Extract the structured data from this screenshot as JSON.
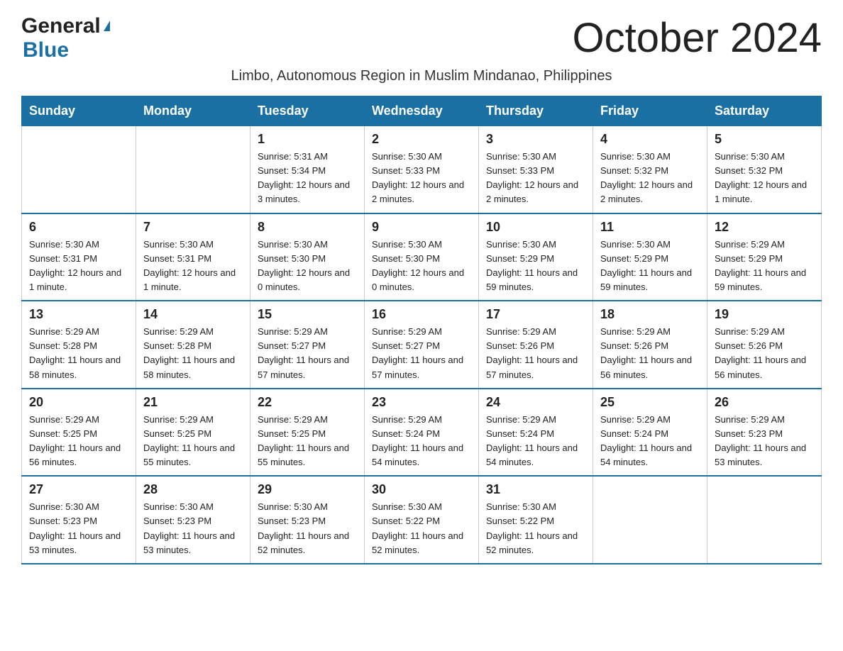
{
  "header": {
    "logo_general": "General",
    "logo_triangle": "▶",
    "logo_blue": "Blue",
    "month_title": "October 2024",
    "subtitle": "Limbo, Autonomous Region in Muslim Mindanao, Philippines"
  },
  "days_of_week": [
    "Sunday",
    "Monday",
    "Tuesday",
    "Wednesday",
    "Thursday",
    "Friday",
    "Saturday"
  ],
  "weeks": [
    [
      {
        "day": "",
        "info": ""
      },
      {
        "day": "",
        "info": ""
      },
      {
        "day": "1",
        "info": "Sunrise: 5:31 AM\nSunset: 5:34 PM\nDaylight: 12 hours\nand 3 minutes."
      },
      {
        "day": "2",
        "info": "Sunrise: 5:30 AM\nSunset: 5:33 PM\nDaylight: 12 hours\nand 2 minutes."
      },
      {
        "day": "3",
        "info": "Sunrise: 5:30 AM\nSunset: 5:33 PM\nDaylight: 12 hours\nand 2 minutes."
      },
      {
        "day": "4",
        "info": "Sunrise: 5:30 AM\nSunset: 5:32 PM\nDaylight: 12 hours\nand 2 minutes."
      },
      {
        "day": "5",
        "info": "Sunrise: 5:30 AM\nSunset: 5:32 PM\nDaylight: 12 hours\nand 1 minute."
      }
    ],
    [
      {
        "day": "6",
        "info": "Sunrise: 5:30 AM\nSunset: 5:31 PM\nDaylight: 12 hours\nand 1 minute."
      },
      {
        "day": "7",
        "info": "Sunrise: 5:30 AM\nSunset: 5:31 PM\nDaylight: 12 hours\nand 1 minute."
      },
      {
        "day": "8",
        "info": "Sunrise: 5:30 AM\nSunset: 5:30 PM\nDaylight: 12 hours\nand 0 minutes."
      },
      {
        "day": "9",
        "info": "Sunrise: 5:30 AM\nSunset: 5:30 PM\nDaylight: 12 hours\nand 0 minutes."
      },
      {
        "day": "10",
        "info": "Sunrise: 5:30 AM\nSunset: 5:29 PM\nDaylight: 11 hours\nand 59 minutes."
      },
      {
        "day": "11",
        "info": "Sunrise: 5:30 AM\nSunset: 5:29 PM\nDaylight: 11 hours\nand 59 minutes."
      },
      {
        "day": "12",
        "info": "Sunrise: 5:29 AM\nSunset: 5:29 PM\nDaylight: 11 hours\nand 59 minutes."
      }
    ],
    [
      {
        "day": "13",
        "info": "Sunrise: 5:29 AM\nSunset: 5:28 PM\nDaylight: 11 hours\nand 58 minutes."
      },
      {
        "day": "14",
        "info": "Sunrise: 5:29 AM\nSunset: 5:28 PM\nDaylight: 11 hours\nand 58 minutes."
      },
      {
        "day": "15",
        "info": "Sunrise: 5:29 AM\nSunset: 5:27 PM\nDaylight: 11 hours\nand 57 minutes."
      },
      {
        "day": "16",
        "info": "Sunrise: 5:29 AM\nSunset: 5:27 PM\nDaylight: 11 hours\nand 57 minutes."
      },
      {
        "day": "17",
        "info": "Sunrise: 5:29 AM\nSunset: 5:26 PM\nDaylight: 11 hours\nand 57 minutes."
      },
      {
        "day": "18",
        "info": "Sunrise: 5:29 AM\nSunset: 5:26 PM\nDaylight: 11 hours\nand 56 minutes."
      },
      {
        "day": "19",
        "info": "Sunrise: 5:29 AM\nSunset: 5:26 PM\nDaylight: 11 hours\nand 56 minutes."
      }
    ],
    [
      {
        "day": "20",
        "info": "Sunrise: 5:29 AM\nSunset: 5:25 PM\nDaylight: 11 hours\nand 56 minutes."
      },
      {
        "day": "21",
        "info": "Sunrise: 5:29 AM\nSunset: 5:25 PM\nDaylight: 11 hours\nand 55 minutes."
      },
      {
        "day": "22",
        "info": "Sunrise: 5:29 AM\nSunset: 5:25 PM\nDaylight: 11 hours\nand 55 minutes."
      },
      {
        "day": "23",
        "info": "Sunrise: 5:29 AM\nSunset: 5:24 PM\nDaylight: 11 hours\nand 54 minutes."
      },
      {
        "day": "24",
        "info": "Sunrise: 5:29 AM\nSunset: 5:24 PM\nDaylight: 11 hours\nand 54 minutes."
      },
      {
        "day": "25",
        "info": "Sunrise: 5:29 AM\nSunset: 5:24 PM\nDaylight: 11 hours\nand 54 minutes."
      },
      {
        "day": "26",
        "info": "Sunrise: 5:29 AM\nSunset: 5:23 PM\nDaylight: 11 hours\nand 53 minutes."
      }
    ],
    [
      {
        "day": "27",
        "info": "Sunrise: 5:30 AM\nSunset: 5:23 PM\nDaylight: 11 hours\nand 53 minutes."
      },
      {
        "day": "28",
        "info": "Sunrise: 5:30 AM\nSunset: 5:23 PM\nDaylight: 11 hours\nand 53 minutes."
      },
      {
        "day": "29",
        "info": "Sunrise: 5:30 AM\nSunset: 5:23 PM\nDaylight: 11 hours\nand 52 minutes."
      },
      {
        "day": "30",
        "info": "Sunrise: 5:30 AM\nSunset: 5:22 PM\nDaylight: 11 hours\nand 52 minutes."
      },
      {
        "day": "31",
        "info": "Sunrise: 5:30 AM\nSunset: 5:22 PM\nDaylight: 11 hours\nand 52 minutes."
      },
      {
        "day": "",
        "info": ""
      },
      {
        "day": "",
        "info": ""
      }
    ]
  ]
}
